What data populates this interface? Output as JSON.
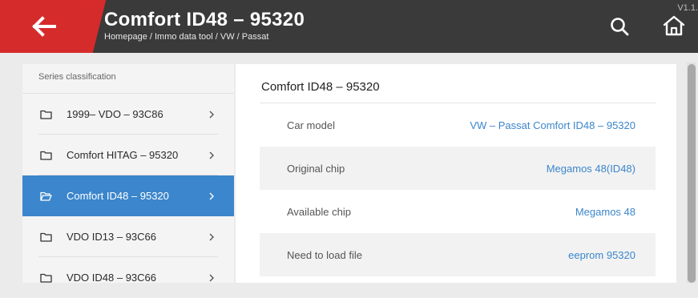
{
  "header": {
    "title": "Comfort ID48 – 95320",
    "breadcrumb": "Homepage / Immo data tool / VW / Passat",
    "version": "V1.1.",
    "back_icon": "arrow-left-icon",
    "search_icon": "search-icon",
    "home_icon": "home-icon",
    "accent": "#d62b2b"
  },
  "sidebar": {
    "heading": "Series classification",
    "items": [
      {
        "label": "1999– VDO – 93C86",
        "active": false
      },
      {
        "label": "Comfort HITAG – 95320",
        "active": false
      },
      {
        "label": "Comfort ID48 – 95320",
        "active": true
      },
      {
        "label": "VDO ID13 – 93C66",
        "active": false
      },
      {
        "label": "VDO ID48 – 93C66",
        "active": false
      }
    ],
    "active_color": "#3b86cc"
  },
  "detail": {
    "title": "Comfort ID48 – 95320",
    "rows": [
      {
        "label": "Car model",
        "value": "VW – Passat Comfort ID48 – 95320"
      },
      {
        "label": "Original chip",
        "value": "Megamos 48(ID48)"
      },
      {
        "label": "Available chip",
        "value": "Megamos 48"
      },
      {
        "label": "Need to load file",
        "value": "eeprom 95320"
      }
    ],
    "value_color": "#3b86cc"
  }
}
